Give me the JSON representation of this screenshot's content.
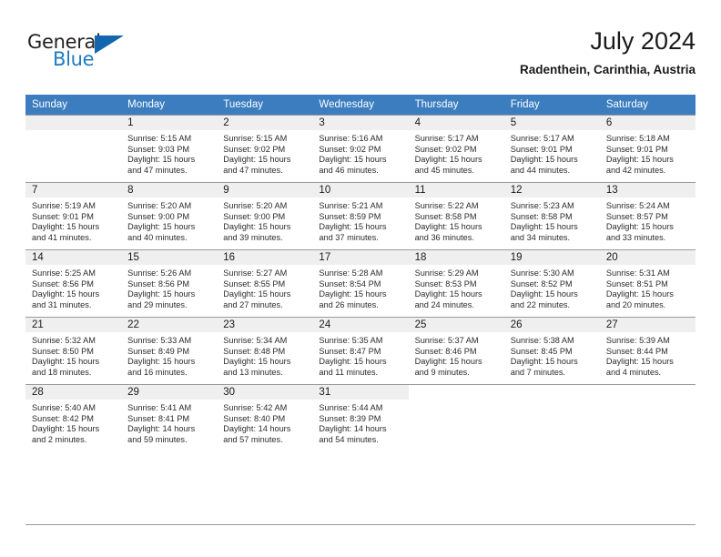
{
  "brand": {
    "name_top": "General",
    "name_bottom": "Blue",
    "logo_icon": "triangle-icon"
  },
  "header": {
    "title": "July 2024",
    "subtitle": "Radenthein, Carinthia, Austria"
  },
  "colors": {
    "header_blue": "#3b7dbf",
    "brand_blue": "#1e7bc1",
    "day_strip": "#efefef",
    "grid_line": "#9a9a9a"
  },
  "weekday_headers": [
    "Sunday",
    "Monday",
    "Tuesday",
    "Wednesday",
    "Thursday",
    "Friday",
    "Saturday"
  ],
  "labels": {
    "sunrise_prefix": "Sunrise:",
    "sunset_prefix": "Sunset:",
    "daylight_prefix": "Daylight:"
  },
  "weeks": [
    [
      {
        "day": "",
        "empty": true
      },
      {
        "day": "1",
        "l1": "Sunrise: 5:15 AM",
        "l2": "Sunset: 9:03 PM",
        "l3": "Daylight: 15 hours",
        "l4": "and 47 minutes."
      },
      {
        "day": "2",
        "l1": "Sunrise: 5:15 AM",
        "l2": "Sunset: 9:02 PM",
        "l3": "Daylight: 15 hours",
        "l4": "and 47 minutes."
      },
      {
        "day": "3",
        "l1": "Sunrise: 5:16 AM",
        "l2": "Sunset: 9:02 PM",
        "l3": "Daylight: 15 hours",
        "l4": "and 46 minutes."
      },
      {
        "day": "4",
        "l1": "Sunrise: 5:17 AM",
        "l2": "Sunset: 9:02 PM",
        "l3": "Daylight: 15 hours",
        "l4": "and 45 minutes."
      },
      {
        "day": "5",
        "l1": "Sunrise: 5:17 AM",
        "l2": "Sunset: 9:01 PM",
        "l3": "Daylight: 15 hours",
        "l4": "and 44 minutes."
      },
      {
        "day": "6",
        "l1": "Sunrise: 5:18 AM",
        "l2": "Sunset: 9:01 PM",
        "l3": "Daylight: 15 hours",
        "l4": "and 42 minutes."
      }
    ],
    [
      {
        "day": "7",
        "l1": "Sunrise: 5:19 AM",
        "l2": "Sunset: 9:01 PM",
        "l3": "Daylight: 15 hours",
        "l4": "and 41 minutes."
      },
      {
        "day": "8",
        "l1": "Sunrise: 5:20 AM",
        "l2": "Sunset: 9:00 PM",
        "l3": "Daylight: 15 hours",
        "l4": "and 40 minutes."
      },
      {
        "day": "9",
        "l1": "Sunrise: 5:20 AM",
        "l2": "Sunset: 9:00 PM",
        "l3": "Daylight: 15 hours",
        "l4": "and 39 minutes."
      },
      {
        "day": "10",
        "l1": "Sunrise: 5:21 AM",
        "l2": "Sunset: 8:59 PM",
        "l3": "Daylight: 15 hours",
        "l4": "and 37 minutes."
      },
      {
        "day": "11",
        "l1": "Sunrise: 5:22 AM",
        "l2": "Sunset: 8:58 PM",
        "l3": "Daylight: 15 hours",
        "l4": "and 36 minutes."
      },
      {
        "day": "12",
        "l1": "Sunrise: 5:23 AM",
        "l2": "Sunset: 8:58 PM",
        "l3": "Daylight: 15 hours",
        "l4": "and 34 minutes."
      },
      {
        "day": "13",
        "l1": "Sunrise: 5:24 AM",
        "l2": "Sunset: 8:57 PM",
        "l3": "Daylight: 15 hours",
        "l4": "and 33 minutes."
      }
    ],
    [
      {
        "day": "14",
        "l1": "Sunrise: 5:25 AM",
        "l2": "Sunset: 8:56 PM",
        "l3": "Daylight: 15 hours",
        "l4": "and 31 minutes."
      },
      {
        "day": "15",
        "l1": "Sunrise: 5:26 AM",
        "l2": "Sunset: 8:56 PM",
        "l3": "Daylight: 15 hours",
        "l4": "and 29 minutes."
      },
      {
        "day": "16",
        "l1": "Sunrise: 5:27 AM",
        "l2": "Sunset: 8:55 PM",
        "l3": "Daylight: 15 hours",
        "l4": "and 27 minutes."
      },
      {
        "day": "17",
        "l1": "Sunrise: 5:28 AM",
        "l2": "Sunset: 8:54 PM",
        "l3": "Daylight: 15 hours",
        "l4": "and 26 minutes."
      },
      {
        "day": "18",
        "l1": "Sunrise: 5:29 AM",
        "l2": "Sunset: 8:53 PM",
        "l3": "Daylight: 15 hours",
        "l4": "and 24 minutes."
      },
      {
        "day": "19",
        "l1": "Sunrise: 5:30 AM",
        "l2": "Sunset: 8:52 PM",
        "l3": "Daylight: 15 hours",
        "l4": "and 22 minutes."
      },
      {
        "day": "20",
        "l1": "Sunrise: 5:31 AM",
        "l2": "Sunset: 8:51 PM",
        "l3": "Daylight: 15 hours",
        "l4": "and 20 minutes."
      }
    ],
    [
      {
        "day": "21",
        "l1": "Sunrise: 5:32 AM",
        "l2": "Sunset: 8:50 PM",
        "l3": "Daylight: 15 hours",
        "l4": "and 18 minutes."
      },
      {
        "day": "22",
        "l1": "Sunrise: 5:33 AM",
        "l2": "Sunset: 8:49 PM",
        "l3": "Daylight: 15 hours",
        "l4": "and 16 minutes."
      },
      {
        "day": "23",
        "l1": "Sunrise: 5:34 AM",
        "l2": "Sunset: 8:48 PM",
        "l3": "Daylight: 15 hours",
        "l4": "and 13 minutes."
      },
      {
        "day": "24",
        "l1": "Sunrise: 5:35 AM",
        "l2": "Sunset: 8:47 PM",
        "l3": "Daylight: 15 hours",
        "l4": "and 11 minutes."
      },
      {
        "day": "25",
        "l1": "Sunrise: 5:37 AM",
        "l2": "Sunset: 8:46 PM",
        "l3": "Daylight: 15 hours",
        "l4": "and 9 minutes."
      },
      {
        "day": "26",
        "l1": "Sunrise: 5:38 AM",
        "l2": "Sunset: 8:45 PM",
        "l3": "Daylight: 15 hours",
        "l4": "and 7 minutes."
      },
      {
        "day": "27",
        "l1": "Sunrise: 5:39 AM",
        "l2": "Sunset: 8:44 PM",
        "l3": "Daylight: 15 hours",
        "l4": "and 4 minutes."
      }
    ],
    [
      {
        "day": "28",
        "l1": "Sunrise: 5:40 AM",
        "l2": "Sunset: 8:42 PM",
        "l3": "Daylight: 15 hours",
        "l4": "and 2 minutes."
      },
      {
        "day": "29",
        "l1": "Sunrise: 5:41 AM",
        "l2": "Sunset: 8:41 PM",
        "l3": "Daylight: 14 hours",
        "l4": "and 59 minutes."
      },
      {
        "day": "30",
        "l1": "Sunrise: 5:42 AM",
        "l2": "Sunset: 8:40 PM",
        "l3": "Daylight: 14 hours",
        "l4": "and 57 minutes."
      },
      {
        "day": "31",
        "l1": "Sunrise: 5:44 AM",
        "l2": "Sunset: 8:39 PM",
        "l3": "Daylight: 14 hours",
        "l4": "and 54 minutes."
      },
      {
        "day": "",
        "empty": true,
        "blank": true
      },
      {
        "day": "",
        "empty": true,
        "blank": true
      },
      {
        "day": "",
        "empty": true,
        "blank": true
      }
    ]
  ]
}
